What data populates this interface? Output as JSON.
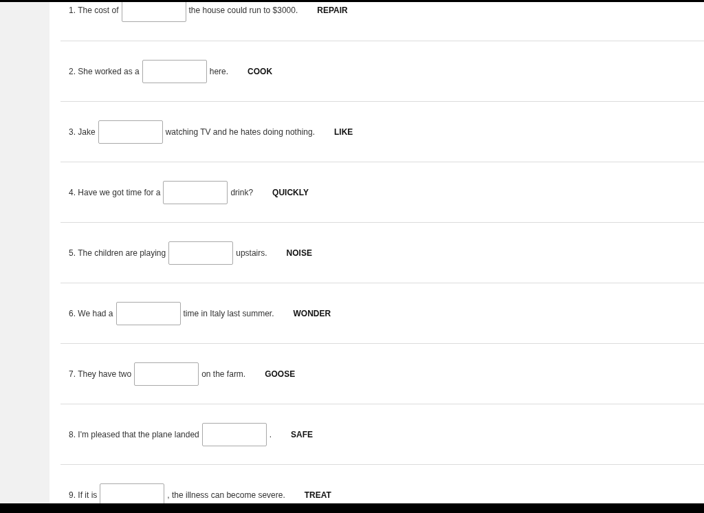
{
  "questions": [
    {
      "before": "1. The cost of",
      "after": "the house could run to $3000.",
      "keyword": "REPAIR"
    },
    {
      "before": "2. She worked as a",
      "after": "here.",
      "keyword": "COOK"
    },
    {
      "before": "3. Jake",
      "after": "watching TV and he hates doing nothing.",
      "keyword": "LIKE"
    },
    {
      "before": "4. Have we got time for a",
      "after": "drink?",
      "keyword": "QUICKLY"
    },
    {
      "before": "5. The children are playing",
      "after": "upstairs.",
      "keyword": "NOISE"
    },
    {
      "before": "6. We had a",
      "after": "time in Italy last summer.",
      "keyword": "WONDER"
    },
    {
      "before": "7. They have two",
      "after": "on the farm.",
      "keyword": "GOOSE"
    },
    {
      "before": "8. I'm pleased that the plane landed",
      "after": ".",
      "keyword": "SAFE"
    },
    {
      "before": "9. If it is",
      "after": ", the illness can become severe.",
      "keyword": "TREAT"
    }
  ]
}
